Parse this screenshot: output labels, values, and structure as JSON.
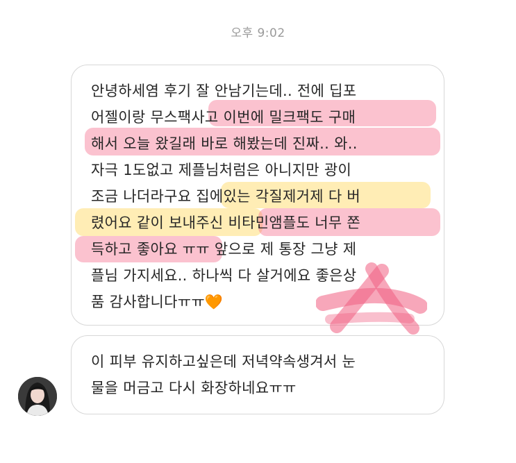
{
  "timestamp": "오후 9:02",
  "messages": [
    {
      "lines": [
        "안녕하세염 후기 잘 안남기는데.. 전에 딥포",
        "어젤이랑 무스팩사고 이번에 밀크팩도 구매",
        "해서 오늘 왔길래 바로 해봤는데 진짜.. 와..",
        "자극 1도없고 제플님처럼은 아니지만 광이",
        "조금 나더라구요 집에있는 각질제거제 다 버",
        "렸어요 같이 보내주신 비타민앰플도 너무 쫀",
        "득하고 좋아요 ㅠㅠ 앞으로 제 통장 그냥 제",
        "플님 가지세요.. 하나씩 다 살거에요 좋은상",
        "품 감사합니다ㅠㅠ🧡"
      ]
    },
    {
      "lines": [
        "이 피부 유지하고싶은데 저녁약속생겨서 눈",
        "물을 머금고 다시 화장하네요ㅠㅠ"
      ]
    }
  ],
  "colors": {
    "highlight_red": "#f56e8c",
    "highlight_yellow": "#ffd65a",
    "bubble_border": "#d7d7d7",
    "timestamp_text": "#9a9a9a"
  }
}
